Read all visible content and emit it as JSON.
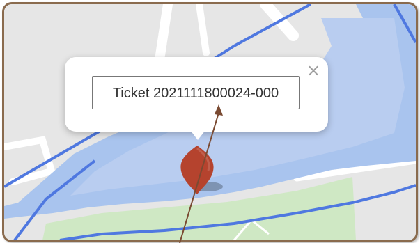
{
  "popup": {
    "ticket_label": "Ticket 2021111800024-000",
    "close_glyph": "×"
  },
  "icons": {
    "close": "close-icon",
    "marker": "map-pin-icon",
    "arrow": "annotation-arrow"
  },
  "colors": {
    "frame_border": "#8a6b4e",
    "land": "#e6e6e6",
    "water": "#a9c4ee",
    "park": "#cfe8c4",
    "boundary": "#4f78e0",
    "marker": "#b5432e",
    "arrow": "#7a4a32"
  }
}
